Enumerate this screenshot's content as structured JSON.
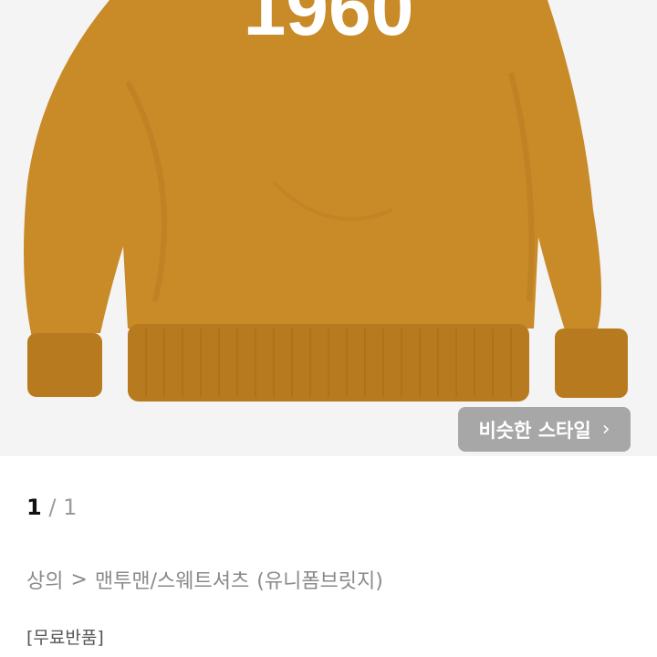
{
  "product_image": {
    "print_text": "1960",
    "colors": {
      "sweatshirt": "#c98a28",
      "rib": "#b87a1f",
      "print": "#ffffff",
      "background": "#f4f4f4"
    }
  },
  "similar_style_button": {
    "label": "비슷한 스타일",
    "icon": "chevron-right-icon"
  },
  "pager": {
    "current": "1",
    "separator": "/",
    "total": "1"
  },
  "breadcrumb": {
    "category": "상의",
    "separator": ">",
    "subcategory": "맨투맨/스웨트셔츠",
    "brand": "(유니폼브릿지)"
  },
  "badge": {
    "label": "[무료반품]"
  }
}
